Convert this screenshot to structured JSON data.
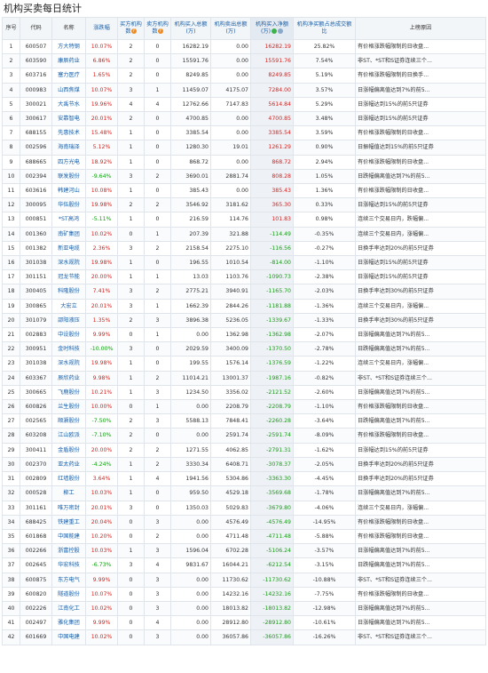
{
  "page_title": "机构买卖每日统计",
  "headers": {
    "seq": "序号",
    "code": "代码",
    "name": "名称",
    "change": "涨跌幅",
    "buy_count": "买方机构数",
    "sell_count": "卖方机构数",
    "buy_amount": "机构买入总额(万)",
    "sell_amount": "机构卖出总额(万)",
    "net_amount": "机构买入净额(万)",
    "ratio": "机构净买额占总成交额比",
    "reason": "上榜原因"
  },
  "rows": [
    {
      "seq": "1",
      "code": "600507",
      "name": "方大特钢",
      "change": "10.07%",
      "buy": "2",
      "sell": "0",
      "buy_amt": "16282.19",
      "sell_amt": "0.00",
      "net": "16282.19",
      "ratio": "25.82%",
      "reason": "有价格涨跌幅限制的日收盘..."
    },
    {
      "seq": "2",
      "code": "603590",
      "name": "康辰药业",
      "change": "6.86%",
      "buy": "2",
      "sell": "0",
      "buy_amt": "15591.76",
      "sell_amt": "0.00",
      "net": "15591.76",
      "ratio": "7.54%",
      "reason": "非ST、*ST和S证券连续三个..."
    },
    {
      "seq": "3",
      "code": "603716",
      "name": "塞力医疗",
      "change": "1.65%",
      "buy": "2",
      "sell": "0",
      "buy_amt": "8249.85",
      "sell_amt": "0.00",
      "net": "8249.85",
      "ratio": "5.19%",
      "reason": "有价格涨跌幅限制的日换手..."
    },
    {
      "seq": "4",
      "code": "000983",
      "name": "山西焦煤",
      "change": "10.07%",
      "buy": "3",
      "sell": "1",
      "buy_amt": "11459.07",
      "sell_amt": "4175.07",
      "net": "7284.00",
      "ratio": "3.57%",
      "reason": "日涨幅偏离值达到7%的前5..."
    },
    {
      "seq": "5",
      "code": "300021",
      "name": "大禹节水",
      "change": "19.96%",
      "buy": "4",
      "sell": "4",
      "buy_amt": "12762.66",
      "sell_amt": "7147.83",
      "net": "5614.84",
      "ratio": "5.29%",
      "reason": "日涨幅达到15%的前5只证券"
    },
    {
      "seq": "6",
      "code": "300617",
      "name": "安靠智电",
      "change": "20.01%",
      "buy": "2",
      "sell": "0",
      "buy_amt": "4700.85",
      "sell_amt": "0.00",
      "net": "4700.85",
      "ratio": "3.48%",
      "reason": "日涨幅达到15%的前5只证券"
    },
    {
      "seq": "7",
      "code": "688155",
      "name": "先惠技术",
      "change": "15.48%",
      "buy": "1",
      "sell": "0",
      "buy_amt": "3385.54",
      "sell_amt": "0.00",
      "net": "3385.54",
      "ratio": "3.59%",
      "reason": "有价格涨跌幅限制的日收盘..."
    },
    {
      "seq": "8",
      "code": "002596",
      "name": "海南瑞泽",
      "change": "5.12%",
      "buy": "1",
      "sell": "0",
      "buy_amt": "1280.30",
      "sell_amt": "19.01",
      "net": "1261.29",
      "ratio": "0.90%",
      "reason": "日振幅值达到15%的前5只证券"
    },
    {
      "seq": "9",
      "code": "688665",
      "name": "四方光电",
      "change": "18.92%",
      "buy": "1",
      "sell": "0",
      "buy_amt": "868.72",
      "sell_amt": "0.00",
      "net": "868.72",
      "ratio": "2.94%",
      "reason": "有价格涨跌幅限制的日收盘..."
    },
    {
      "seq": "10",
      "code": "002394",
      "name": "联发股份",
      "change": "-9.64%",
      "buy": "3",
      "sell": "2",
      "buy_amt": "3690.01",
      "sell_amt": "2881.74",
      "net": "808.28",
      "ratio": "1.05%",
      "reason": "日跌幅偏离值达到7%的前5..."
    },
    {
      "seq": "11",
      "code": "603616",
      "name": "韩建河山",
      "change": "10.08%",
      "buy": "1",
      "sell": "0",
      "buy_amt": "385.43",
      "sell_amt": "0.00",
      "net": "385.43",
      "ratio": "1.36%",
      "reason": "有价格涨跌幅限制的日收盘..."
    },
    {
      "seq": "12",
      "code": "300095",
      "name": "华伍股份",
      "change": "19.98%",
      "buy": "2",
      "sell": "2",
      "buy_amt": "3546.92",
      "sell_amt": "3181.62",
      "net": "365.30",
      "ratio": "0.33%",
      "reason": "日涨幅达到15%的前5只证券"
    },
    {
      "seq": "13",
      "code": "000851",
      "name": "*ST高鸿",
      "change": "-5.11%",
      "buy": "1",
      "sell": "0",
      "buy_amt": "216.59",
      "sell_amt": "114.76",
      "net": "101.83",
      "ratio": "0.98%",
      "reason": "连续三个交易日内，跌幅偏..."
    },
    {
      "seq": "14",
      "code": "001360",
      "name": "南矿集团",
      "change": "10.02%",
      "buy": "0",
      "sell": "1",
      "buy_amt": "207.39",
      "sell_amt": "321.88",
      "net": "-114.49",
      "ratio": "-0.35%",
      "reason": "连续三个交易日内，涨幅偏..."
    },
    {
      "seq": "15",
      "code": "001382",
      "name": "新亚电缆",
      "change": "2.36%",
      "buy": "3",
      "sell": "2",
      "buy_amt": "2158.54",
      "sell_amt": "2275.10",
      "net": "-116.56",
      "ratio": "-0.27%",
      "reason": "日换手率达到20%的前5只证券"
    },
    {
      "seq": "16",
      "code": "301038",
      "name": "深水规院",
      "change": "19.98%",
      "buy": "1",
      "sell": "0",
      "buy_amt": "196.55",
      "sell_amt": "1010.54",
      "net": "-814.00",
      "ratio": "-1.10%",
      "reason": "日涨幅达到15%的前5只证券"
    },
    {
      "seq": "17",
      "code": "301151",
      "name": "冠龙节能",
      "change": "20.00%",
      "buy": "1",
      "sell": "1",
      "buy_amt": "13.03",
      "sell_amt": "1103.76",
      "net": "-1090.73",
      "ratio": "-2.38%",
      "reason": "日涨幅达到15%的前5只证券"
    },
    {
      "seq": "18",
      "code": "300405",
      "name": "科隆股份",
      "change": "7.41%",
      "buy": "3",
      "sell": "2",
      "buy_amt": "2775.21",
      "sell_amt": "3940.91",
      "net": "-1165.70",
      "ratio": "-2.03%",
      "reason": "日换手率达到30%的前5只证券"
    },
    {
      "seq": "19",
      "code": "300865",
      "name": "大宏立",
      "change": "20.01%",
      "buy": "3",
      "sell": "1",
      "buy_amt": "1662.39",
      "sell_amt": "2844.26",
      "net": "-1181.88",
      "ratio": "-1.36%",
      "reason": "连续三个交易日内，涨幅偏..."
    },
    {
      "seq": "20",
      "code": "301079",
      "name": "邵阳液压",
      "change": "1.35%",
      "buy": "2",
      "sell": "3",
      "buy_amt": "3896.38",
      "sell_amt": "5236.05",
      "net": "-1339.67",
      "ratio": "-1.33%",
      "reason": "日换手率达到30%的前5只证券"
    },
    {
      "seq": "21",
      "code": "002883",
      "name": "中设股份",
      "change": "9.99%",
      "buy": "0",
      "sell": "1",
      "buy_amt": "0.00",
      "sell_amt": "1362.98",
      "net": "-1362.98",
      "ratio": "-2.07%",
      "reason": "日涨幅偏离值达到7%的前5..."
    },
    {
      "seq": "22",
      "code": "300951",
      "name": "金时科技",
      "change": "-10.00%",
      "buy": "3",
      "sell": "0",
      "buy_amt": "2029.59",
      "sell_amt": "3400.09",
      "net": "-1370.50",
      "ratio": "-2.78%",
      "reason": "日跌幅偏离值达到7%的前5..."
    },
    {
      "seq": "23",
      "code": "301038",
      "name": "深水规院",
      "change": "19.98%",
      "buy": "1",
      "sell": "0",
      "buy_amt": "199.55",
      "sell_amt": "1576.14",
      "net": "-1376.59",
      "ratio": "-1.22%",
      "reason": "连续三个交易日内，涨幅偏..."
    },
    {
      "seq": "24",
      "code": "603367",
      "name": "辰欣药业",
      "change": "9.98%",
      "buy": "1",
      "sell": "2",
      "buy_amt": "11014.21",
      "sell_amt": "13001.37",
      "net": "-1987.16",
      "ratio": "-0.82%",
      "reason": "非ST、*ST和S证券连续三个..."
    },
    {
      "seq": "25",
      "code": "300665",
      "name": "飞鹿股份",
      "change": "10.21%",
      "buy": "1",
      "sell": "3",
      "buy_amt": "1234.50",
      "sell_amt": "3356.02",
      "net": "-2121.52",
      "ratio": "-2.60%",
      "reason": "日涨幅偏离值达到7%的前5..."
    },
    {
      "seq": "26",
      "code": "600826",
      "name": "兰生股份",
      "change": "10.00%",
      "buy": "0",
      "sell": "1",
      "buy_amt": "0.00",
      "sell_amt": "2208.79",
      "net": "-2208.79",
      "ratio": "-1.10%",
      "reason": "有价格涨跌幅限制的日收盘..."
    },
    {
      "seq": "27",
      "code": "002565",
      "name": "顺灏股份",
      "change": "-7.50%",
      "buy": "2",
      "sell": "3",
      "buy_amt": "5588.13",
      "sell_amt": "7848.41",
      "net": "-2260.28",
      "ratio": "-3.64%",
      "reason": "日跌幅偏离值达到7%的前5..."
    },
    {
      "seq": "28",
      "code": "603208",
      "name": "江山欧派",
      "change": "-7.10%",
      "buy": "2",
      "sell": "0",
      "buy_amt": "0.00",
      "sell_amt": "2591.74",
      "net": "-2591.74",
      "ratio": "-8.09%",
      "reason": "有价格涨跌幅限制的日收盘..."
    },
    {
      "seq": "29",
      "code": "300411",
      "name": "金盾股份",
      "change": "20.00%",
      "buy": "2",
      "sell": "2",
      "buy_amt": "1271.55",
      "sell_amt": "4062.85",
      "net": "-2791.31",
      "ratio": "-1.62%",
      "reason": "日涨幅达到15%的前5只证券"
    },
    {
      "seq": "30",
      "code": "002370",
      "name": "亚太药业",
      "change": "-4.24%",
      "buy": "1",
      "sell": "2",
      "buy_amt": "3330.34",
      "sell_amt": "6408.71",
      "net": "-3078.37",
      "ratio": "-2.05%",
      "reason": "日换手率达到20%的前5只证券"
    },
    {
      "seq": "31",
      "code": "002809",
      "name": "红墙股份",
      "change": "3.64%",
      "buy": "1",
      "sell": "4",
      "buy_amt": "1941.56",
      "sell_amt": "5304.86",
      "net": "-3363.30",
      "ratio": "-4.45%",
      "reason": "日换手率达到20%的前5只证券"
    },
    {
      "seq": "32",
      "code": "000528",
      "name": "柳工",
      "change": "10.03%",
      "buy": "1",
      "sell": "0",
      "buy_amt": "959.50",
      "sell_amt": "4529.18",
      "net": "-3569.68",
      "ratio": "-1.78%",
      "reason": "日涨幅偏离值达到7%的前5..."
    },
    {
      "seq": "33",
      "code": "301161",
      "name": "唯万密封",
      "change": "20.01%",
      "buy": "3",
      "sell": "0",
      "buy_amt": "1350.03",
      "sell_amt": "5029.83",
      "net": "-3679.80",
      "ratio": "-4.06%",
      "reason": "连续三个交易日内，涨幅偏..."
    },
    {
      "seq": "34",
      "code": "688425",
      "name": "铁建重工",
      "change": "20.04%",
      "buy": "0",
      "sell": "3",
      "buy_amt": "0.00",
      "sell_amt": "4576.49",
      "net": "-4576.49",
      "ratio": "-14.95%",
      "reason": "有价格涨跌幅限制的日收盘..."
    },
    {
      "seq": "35",
      "code": "601868",
      "name": "中国能建",
      "change": "10.20%",
      "buy": "0",
      "sell": "2",
      "buy_amt": "0.00",
      "sell_amt": "4711.48",
      "net": "-4711.48",
      "ratio": "-5.88%",
      "reason": "有价格涨跌幅限制的日收盘..."
    },
    {
      "seq": "36",
      "code": "002266",
      "name": "浙富控股",
      "change": "10.03%",
      "buy": "1",
      "sell": "3",
      "buy_amt": "1596.04",
      "sell_amt": "6702.28",
      "net": "-5106.24",
      "ratio": "-3.57%",
      "reason": "日涨幅偏离值达到7%的前5..."
    },
    {
      "seq": "37",
      "code": "002645",
      "name": "华宏科技",
      "change": "-6.73%",
      "buy": "3",
      "sell": "4",
      "buy_amt": "9831.67",
      "sell_amt": "16044.21",
      "net": "-6212.54",
      "ratio": "-3.15%",
      "reason": "日跌幅偏离值达到7%的前5..."
    },
    {
      "seq": "38",
      "code": "600875",
      "name": "东方电气",
      "change": "9.99%",
      "buy": "0",
      "sell": "3",
      "buy_amt": "0.00",
      "sell_amt": "11730.62",
      "net": "-11730.62",
      "ratio": "-10.88%",
      "reason": "非ST、*ST和S证券连续三个..."
    },
    {
      "seq": "39",
      "code": "600820",
      "name": "隧道股份",
      "change": "10.07%",
      "buy": "0",
      "sell": "3",
      "buy_amt": "0.00",
      "sell_amt": "14232.16",
      "net": "-14232.16",
      "ratio": "-7.75%",
      "reason": "有价格涨跌幅限制的日收盘..."
    },
    {
      "seq": "40",
      "code": "002226",
      "name": "江南化工",
      "change": "10.02%",
      "buy": "0",
      "sell": "3",
      "buy_amt": "0.00",
      "sell_amt": "18013.82",
      "net": "-18013.82",
      "ratio": "-12.98%",
      "reason": "日涨幅偏离值达到7%的前5..."
    },
    {
      "seq": "41",
      "code": "002497",
      "name": "雅化集团",
      "change": "9.99%",
      "buy": "0",
      "sell": "4",
      "buy_amt": "0.00",
      "sell_amt": "28912.80",
      "net": "-28912.80",
      "ratio": "-10.61%",
      "reason": "日涨幅偏离值达到7%的前5..."
    },
    {
      "seq": "42",
      "code": "601669",
      "name": "中国电建",
      "change": "10.02%",
      "buy": "0",
      "sell": "3",
      "buy_amt": "0.00",
      "sell_amt": "36057.86",
      "net": "-36057.86",
      "ratio": "-16.26%",
      "reason": "非ST、*ST和S证券连续三个..."
    }
  ]
}
